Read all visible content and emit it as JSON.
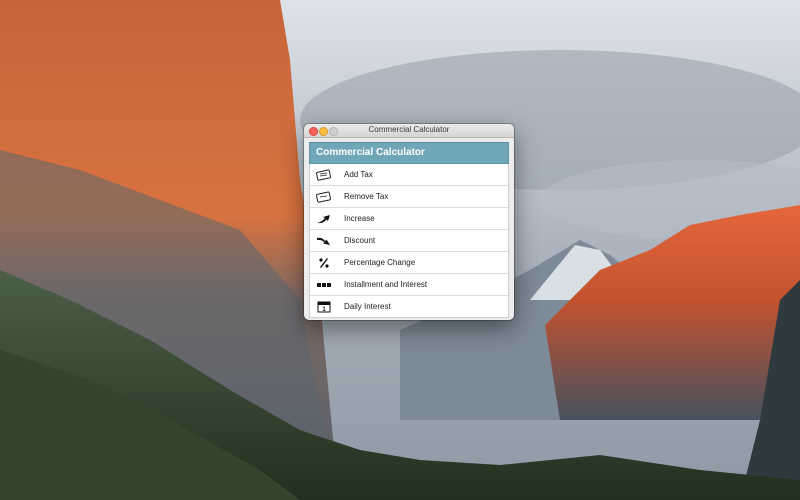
{
  "window": {
    "title": "Commercial Calculator"
  },
  "app": {
    "header": "Commercial Calculator",
    "items": [
      {
        "label": "Add Tax",
        "icon": "calculator-plus-icon"
      },
      {
        "label": "Remove Tax",
        "icon": "calculator-minus-icon"
      },
      {
        "label": "Increase",
        "icon": "arrow-up-icon"
      },
      {
        "label": "Discount",
        "icon": "arrow-down-icon"
      },
      {
        "label": "Percentage Change",
        "icon": "percent-icon"
      },
      {
        "label": "Installment and Interest",
        "icon": "installments-icon"
      },
      {
        "label": "Daily Interest",
        "icon": "calendar-icon"
      }
    ]
  },
  "colors": {
    "header_bg": "#6fa6b8",
    "close": "#fc605c",
    "minimize": "#fdbc40",
    "maximize": "#cfcfcf"
  }
}
